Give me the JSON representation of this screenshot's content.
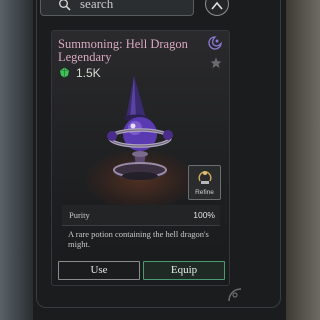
{
  "search": {
    "placeholder": "search"
  },
  "item": {
    "title": "Summoning: Hell Dragon",
    "rarity": "Legendary",
    "value": "1.5K",
    "refine_label": "Refine",
    "stat_label": "Purity",
    "stat_value": "100%",
    "description": "A rare potion containing the hell dragon's might."
  },
  "actions": {
    "use_label": "Use",
    "equip_label": "Equip"
  },
  "colors": {
    "legendary_text": "#d9a8c0",
    "equip_accent": "#4a9a72",
    "gem": "#3fbf5a",
    "potion": "#6a48b8"
  },
  "icons": {
    "search": "search-icon",
    "close": "close-icon",
    "faction": "faction-icon",
    "favorite": "star-icon",
    "gem": "gem-icon",
    "refine": "anvil-icon"
  }
}
